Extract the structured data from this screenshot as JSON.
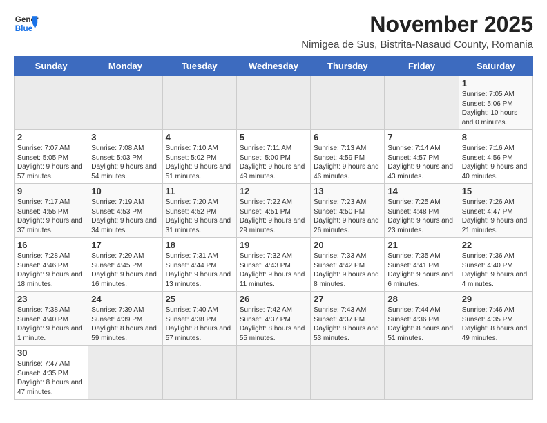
{
  "header": {
    "logo_general": "General",
    "logo_blue": "Blue",
    "month_title": "November 2025",
    "subtitle": "Nimigea de Sus, Bistrita-Nasaud County, Romania"
  },
  "weekdays": [
    "Sunday",
    "Monday",
    "Tuesday",
    "Wednesday",
    "Thursday",
    "Friday",
    "Saturday"
  ],
  "weeks": [
    [
      {
        "day": "",
        "info": ""
      },
      {
        "day": "",
        "info": ""
      },
      {
        "day": "",
        "info": ""
      },
      {
        "day": "",
        "info": ""
      },
      {
        "day": "",
        "info": ""
      },
      {
        "day": "",
        "info": ""
      },
      {
        "day": "1",
        "info": "Sunrise: 7:05 AM\nSunset: 5:06 PM\nDaylight: 10 hours and 0 minutes."
      }
    ],
    [
      {
        "day": "2",
        "info": "Sunrise: 7:07 AM\nSunset: 5:05 PM\nDaylight: 9 hours and 57 minutes."
      },
      {
        "day": "3",
        "info": "Sunrise: 7:08 AM\nSunset: 5:03 PM\nDaylight: 9 hours and 54 minutes."
      },
      {
        "day": "4",
        "info": "Sunrise: 7:10 AM\nSunset: 5:02 PM\nDaylight: 9 hours and 51 minutes."
      },
      {
        "day": "5",
        "info": "Sunrise: 7:11 AM\nSunset: 5:00 PM\nDaylight: 9 hours and 49 minutes."
      },
      {
        "day": "6",
        "info": "Sunrise: 7:13 AM\nSunset: 4:59 PM\nDaylight: 9 hours and 46 minutes."
      },
      {
        "day": "7",
        "info": "Sunrise: 7:14 AM\nSunset: 4:57 PM\nDaylight: 9 hours and 43 minutes."
      },
      {
        "day": "8",
        "info": "Sunrise: 7:16 AM\nSunset: 4:56 PM\nDaylight: 9 hours and 40 minutes."
      }
    ],
    [
      {
        "day": "9",
        "info": "Sunrise: 7:17 AM\nSunset: 4:55 PM\nDaylight: 9 hours and 37 minutes."
      },
      {
        "day": "10",
        "info": "Sunrise: 7:19 AM\nSunset: 4:53 PM\nDaylight: 9 hours and 34 minutes."
      },
      {
        "day": "11",
        "info": "Sunrise: 7:20 AM\nSunset: 4:52 PM\nDaylight: 9 hours and 31 minutes."
      },
      {
        "day": "12",
        "info": "Sunrise: 7:22 AM\nSunset: 4:51 PM\nDaylight: 9 hours and 29 minutes."
      },
      {
        "day": "13",
        "info": "Sunrise: 7:23 AM\nSunset: 4:50 PM\nDaylight: 9 hours and 26 minutes."
      },
      {
        "day": "14",
        "info": "Sunrise: 7:25 AM\nSunset: 4:48 PM\nDaylight: 9 hours and 23 minutes."
      },
      {
        "day": "15",
        "info": "Sunrise: 7:26 AM\nSunset: 4:47 PM\nDaylight: 9 hours and 21 minutes."
      }
    ],
    [
      {
        "day": "16",
        "info": "Sunrise: 7:28 AM\nSunset: 4:46 PM\nDaylight: 9 hours and 18 minutes."
      },
      {
        "day": "17",
        "info": "Sunrise: 7:29 AM\nSunset: 4:45 PM\nDaylight: 9 hours and 16 minutes."
      },
      {
        "day": "18",
        "info": "Sunrise: 7:31 AM\nSunset: 4:44 PM\nDaylight: 9 hours and 13 minutes."
      },
      {
        "day": "19",
        "info": "Sunrise: 7:32 AM\nSunset: 4:43 PM\nDaylight: 9 hours and 11 minutes."
      },
      {
        "day": "20",
        "info": "Sunrise: 7:33 AM\nSunset: 4:42 PM\nDaylight: 9 hours and 8 minutes."
      },
      {
        "day": "21",
        "info": "Sunrise: 7:35 AM\nSunset: 4:41 PM\nDaylight: 9 hours and 6 minutes."
      },
      {
        "day": "22",
        "info": "Sunrise: 7:36 AM\nSunset: 4:40 PM\nDaylight: 9 hours and 4 minutes."
      }
    ],
    [
      {
        "day": "23",
        "info": "Sunrise: 7:38 AM\nSunset: 4:40 PM\nDaylight: 9 hours and 1 minute."
      },
      {
        "day": "24",
        "info": "Sunrise: 7:39 AM\nSunset: 4:39 PM\nDaylight: 8 hours and 59 minutes."
      },
      {
        "day": "25",
        "info": "Sunrise: 7:40 AM\nSunset: 4:38 PM\nDaylight: 8 hours and 57 minutes."
      },
      {
        "day": "26",
        "info": "Sunrise: 7:42 AM\nSunset: 4:37 PM\nDaylight: 8 hours and 55 minutes."
      },
      {
        "day": "27",
        "info": "Sunrise: 7:43 AM\nSunset: 4:37 PM\nDaylight: 8 hours and 53 minutes."
      },
      {
        "day": "28",
        "info": "Sunrise: 7:44 AM\nSunset: 4:36 PM\nDaylight: 8 hours and 51 minutes."
      },
      {
        "day": "29",
        "info": "Sunrise: 7:46 AM\nSunset: 4:35 PM\nDaylight: 8 hours and 49 minutes."
      }
    ],
    [
      {
        "day": "30",
        "info": "Sunrise: 7:47 AM\nSunset: 4:35 PM\nDaylight: 8 hours and 47 minutes."
      },
      {
        "day": "",
        "info": ""
      },
      {
        "day": "",
        "info": ""
      },
      {
        "day": "",
        "info": ""
      },
      {
        "day": "",
        "info": ""
      },
      {
        "day": "",
        "info": ""
      },
      {
        "day": "",
        "info": ""
      }
    ]
  ]
}
